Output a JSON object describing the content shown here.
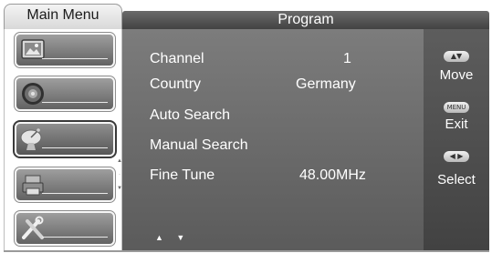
{
  "header": {
    "menu_tab": "Main Menu",
    "title": "Program"
  },
  "sidebar": {
    "items": [
      {
        "icon": "picture-icon"
      },
      {
        "icon": "sound-icon"
      },
      {
        "icon": "satellite-dish-icon"
      },
      {
        "icon": "timer-icon"
      },
      {
        "icon": "tools-icon"
      }
    ],
    "active_index": 2,
    "scroll_up": "▲",
    "scroll_mid": "·",
    "scroll_down": "▼"
  },
  "program": {
    "channel_label": "Channel",
    "channel_value": "1",
    "country_label": "Country",
    "country_value": "Germany",
    "auto_search_label": "Auto Search",
    "manual_search_label": "Manual Search",
    "fine_tune_label": "Fine Tune",
    "fine_tune_value": "48.00MHz",
    "nav_hint": "▲ ▼"
  },
  "help": {
    "move_key": "▲▼",
    "move_label": "Move",
    "exit_key": "MENU",
    "exit_label": "Exit",
    "select_key": "◀ ▶",
    "select_label": "Select"
  }
}
